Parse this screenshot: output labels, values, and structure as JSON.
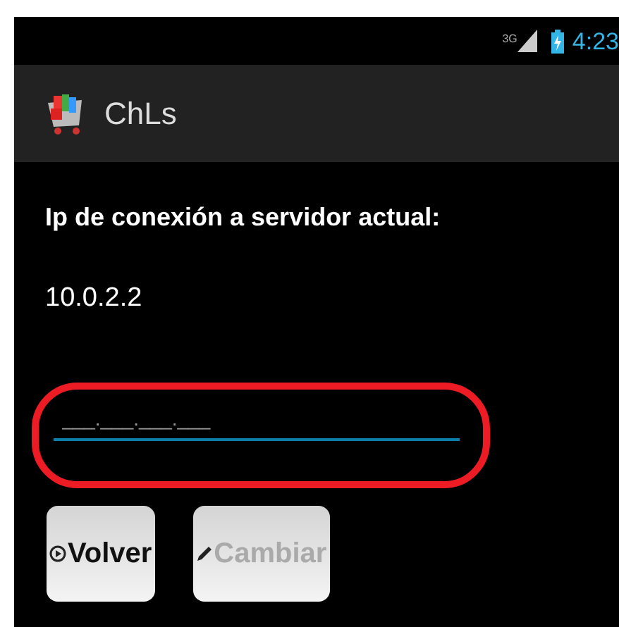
{
  "status_bar": {
    "network": "3G",
    "time": "4:23"
  },
  "action_bar": {
    "title": "ChLs"
  },
  "label": "Ip de conexión a servidor actual:",
  "current_ip": "10.0.2.2",
  "ip_field": {
    "placeholder": "___.___.___.___",
    "focused": true
  },
  "buttons": [
    {
      "label": "Volver",
      "kind": "back",
      "disabled": false
    },
    {
      "label": "Cambiar",
      "kind": "edit",
      "disabled": true
    }
  ]
}
